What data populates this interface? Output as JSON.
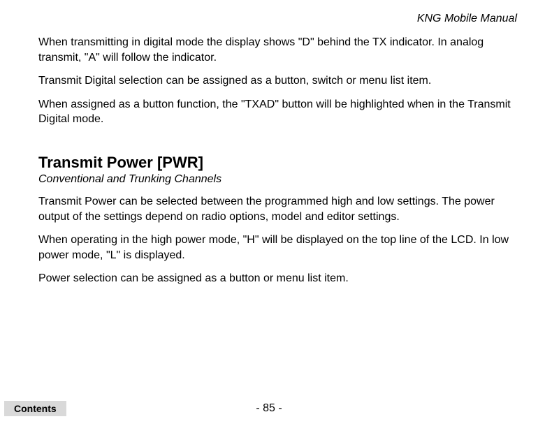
{
  "header": {
    "manual_title": "KNG Mobile Manual"
  },
  "body": {
    "paragraphs": {
      "p1": "When transmitting in digital mode the display shows \"D\" behind the TX indicator. In analog transmit, \"A\" will follow the indicator.",
      "p2": "Transmit Digital selection can be assigned as a button, switch or menu list item.",
      "p3": "When assigned as a button function, the \"TXAD\" button will be highlighted when in the Transmit Digital mode."
    },
    "section": {
      "heading": "Transmit Power [PWR]",
      "subheading": "Conventional and Trunking Channels",
      "p4": "Transmit Power can be selected between the programmed high and low settings. The power output of the settings depend on radio options, model and editor settings.",
      "p5": "When operating in the high power mode, \"H\" will be displayed on the top line of the LCD. In low power mode, \"L\" is displayed.",
      "p6": "Power selection can be assigned as a button or menu list item."
    }
  },
  "footer": {
    "contents_label": "Contents",
    "page_number": "- 85 -"
  }
}
